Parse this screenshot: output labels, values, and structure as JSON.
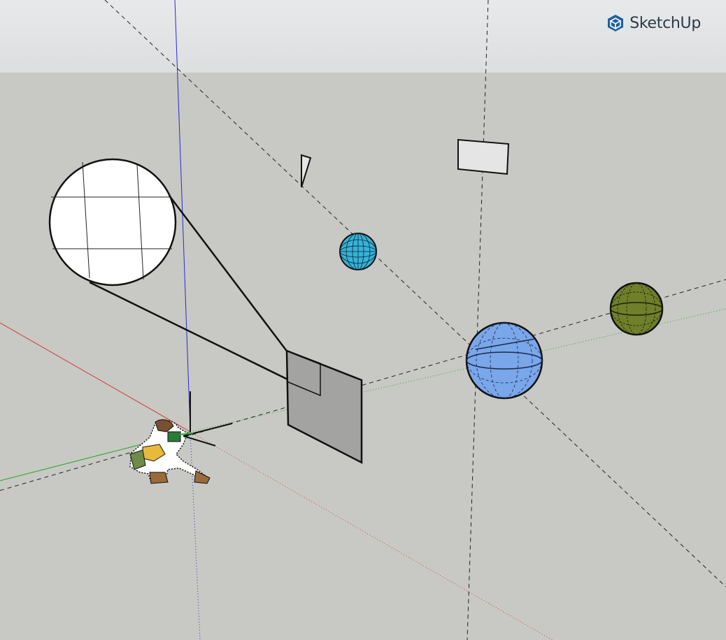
{
  "app": {
    "brand_name": "SketchUp",
    "brand_icon": "sketchup-logo-icon",
    "brand_color": "#1f5f9e"
  },
  "scene": {
    "sky_color": "#e3e4e5",
    "ground_color": "#c8c9c4",
    "axis_colors": {
      "red": "#d23b3b",
      "green": "#2aa52a",
      "blue": "#2a2ad0"
    },
    "objects": [
      {
        "name": "magnifier-circle",
        "fill": "#ffffff"
      },
      {
        "name": "gray-panel",
        "fill": "#a3a4a2"
      },
      {
        "name": "small-rectangle",
        "fill": "#e4e5e4"
      },
      {
        "name": "cyan-sphere",
        "fill": "#35b3d8"
      },
      {
        "name": "blue-sphere",
        "fill": "#7aa6ea"
      },
      {
        "name": "green-sphere",
        "fill": "#6f7f2a"
      },
      {
        "name": "person-figure",
        "fill": "#e8b93a"
      }
    ]
  }
}
